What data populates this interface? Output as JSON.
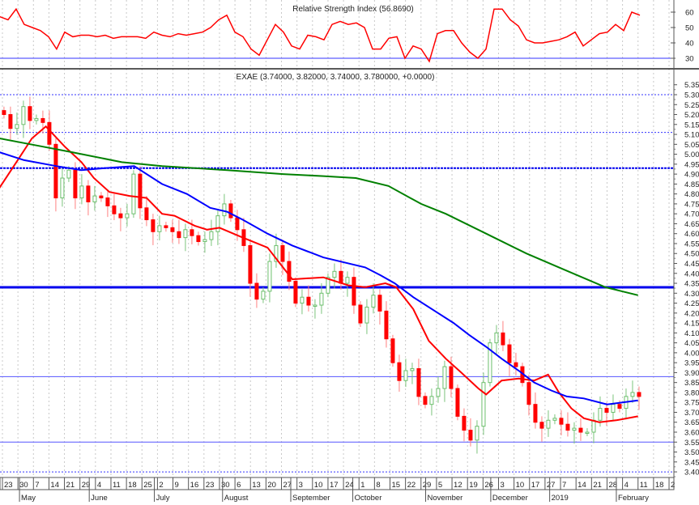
{
  "chart_data": [
    {
      "type": "line",
      "title": "Relative Strength Index (56.8690)",
      "ylim": [
        25,
        65
      ],
      "y_ticks": [
        "60",
        "50",
        "40",
        "30"
      ],
      "y_tick_values": [
        60,
        50,
        40,
        30
      ],
      "reference_line": 30,
      "series": [
        {
          "name": "RSI",
          "color": "#ff0000",
          "x_start_week": -0.16,
          "x_step_week": 0.5225,
          "values": [
            57,
            55,
            62,
            52,
            50,
            48,
            44,
            36,
            47,
            44,
            45,
            45,
            44,
            45,
            43,
            44,
            44,
            44,
            43,
            47,
            45,
            44,
            46,
            45,
            46,
            47,
            50,
            55,
            58,
            47,
            44,
            36,
            32,
            42,
            52,
            47,
            38,
            36,
            45,
            44,
            42,
            52,
            54,
            52,
            53,
            50,
            36,
            36,
            43,
            44,
            30,
            38,
            36,
            28,
            46,
            48,
            48,
            40,
            34,
            30,
            36,
            62,
            62,
            55,
            51,
            42,
            40,
            40,
            41,
            42,
            44,
            47,
            38,
            42,
            46,
            47,
            52,
            48,
            60,
            58
          ]
        }
      ]
    },
    {
      "type": "candlestick",
      "title": "EXAE (3.74000, 3.82000, 3.74000, 3.780000, +0.0000)",
      "ylim": [
        3.4,
        5.35
      ],
      "y_ticks": [
        "5.35",
        "5.30",
        "5.25",
        "5.20",
        "5.15",
        "5.10",
        "5.05",
        "5.00",
        "4.95",
        "4.90",
        "4.85",
        "4.80",
        "4.75",
        "4.70",
        "4.65",
        "4.60",
        "4.55",
        "4.50",
        "4.45",
        "4.40",
        "4.35",
        "4.30",
        "4.25",
        "4.20",
        "4.15",
        "4.10",
        "4.05",
        "4.00",
        "3.95",
        "3.90",
        "3.85",
        "3.80",
        "3.75",
        "3.70",
        "3.65",
        "3.60",
        "3.55",
        "3.50",
        "3.45",
        "3.40"
      ],
      "candles": {
        "x_start_week": 0.1,
        "x_step_week": 0.418,
        "close": [
          5.2,
          5.13,
          5.15,
          5.24,
          5.17,
          5.18,
          5.16,
          5.05,
          4.78,
          4.88,
          4.92,
          4.78,
          4.84,
          4.76,
          4.79,
          4.78,
          4.74,
          4.7,
          4.68,
          4.7,
          4.9,
          4.73,
          4.67,
          4.61,
          4.64,
          4.63,
          4.61,
          4.58,
          4.62,
          4.59,
          4.56,
          4.57,
          4.61,
          4.69,
          4.75,
          4.68,
          4.62,
          4.54,
          4.35,
          4.27,
          4.31,
          4.46,
          4.54,
          4.46,
          4.36,
          4.25,
          4.28,
          4.24,
          4.24,
          4.3,
          4.38,
          4.41,
          4.35,
          4.38,
          4.24,
          4.15,
          4.23,
          4.29,
          4.21,
          4.07,
          3.95,
          3.86,
          3.91,
          3.92,
          3.78,
          3.74,
          3.78,
          3.82,
          3.93,
          3.82,
          3.68,
          3.61,
          3.56,
          3.63,
          3.85,
          4.05,
          4.1,
          4.04,
          3.95,
          3.93,
          3.85,
          3.74,
          3.65,
          3.62,
          3.66,
          3.67,
          3.64,
          3.61,
          3.62,
          3.6,
          3.6,
          3.66,
          3.72,
          3.7,
          3.74,
          3.72,
          3.78,
          3.8,
          3.78
        ],
        "up_color": "#90d090",
        "down_color": "#ff0000"
      },
      "moving_averages": [
        {
          "name": "MA short",
          "color": "#ff0000",
          "points": [
            [
              -0.2,
              4.83
            ],
            [
              0.9,
              4.96
            ],
            [
              1.9,
              5.08
            ],
            [
              2.8,
              5.14
            ],
            [
              4.0,
              5.04
            ],
            [
              5.1,
              4.96
            ],
            [
              5.9,
              4.88
            ],
            [
              6.9,
              4.81
            ],
            [
              8.2,
              4.79
            ],
            [
              9.3,
              4.78
            ],
            [
              10.3,
              4.7
            ],
            [
              11.1,
              4.69
            ],
            [
              12.4,
              4.64
            ],
            [
              13.2,
              4.62
            ],
            [
              14.0,
              4.63
            ],
            [
              15.5,
              4.58
            ],
            [
              17.1,
              4.53
            ],
            [
              17.9,
              4.45
            ],
            [
              18.7,
              4.37
            ],
            [
              20.7,
              4.38
            ],
            [
              22.3,
              4.34
            ],
            [
              23.4,
              4.33
            ],
            [
              24.7,
              4.35
            ],
            [
              25.4,
              4.33
            ],
            [
              26.5,
              4.22
            ],
            [
              27.5,
              4.06
            ],
            [
              28.6,
              3.97
            ],
            [
              29.6,
              3.9
            ],
            [
              30.7,
              3.82
            ],
            [
              31.2,
              3.79
            ],
            [
              32.2,
              3.86
            ],
            [
              33.3,
              3.87
            ],
            [
              34.3,
              3.86
            ],
            [
              35.2,
              3.89
            ],
            [
              35.9,
              3.8
            ],
            [
              36.7,
              3.72
            ],
            [
              37.5,
              3.67
            ],
            [
              38.5,
              3.65
            ],
            [
              39.6,
              3.66
            ],
            [
              41.0,
              3.68
            ]
          ]
        },
        {
          "name": "MA medium",
          "color": "#0000ff",
          "points": [
            [
              -0.2,
              5.01
            ],
            [
              1.4,
              4.97
            ],
            [
              3.5,
              4.94
            ],
            [
              5.1,
              4.92
            ],
            [
              6.6,
              4.93
            ],
            [
              8.5,
              4.94
            ],
            [
              10.3,
              4.85
            ],
            [
              11.9,
              4.8
            ],
            [
              13.4,
              4.73
            ],
            [
              14.5,
              4.71
            ],
            [
              15.5,
              4.67
            ],
            [
              17.1,
              4.6
            ],
            [
              18.7,
              4.54
            ],
            [
              20.7,
              4.48
            ],
            [
              23.4,
              4.43
            ],
            [
              24.4,
              4.39
            ],
            [
              25.3,
              4.35
            ],
            [
              26.5,
              4.28
            ],
            [
              28.1,
              4.2
            ],
            [
              29.1,
              4.15
            ],
            [
              30.1,
              4.09
            ],
            [
              31.2,
              4.03
            ],
            [
              32.2,
              3.97
            ],
            [
              33.3,
              3.91
            ],
            [
              34.3,
              3.85
            ],
            [
              35.4,
              3.81
            ],
            [
              36.4,
              3.78
            ],
            [
              37.5,
              3.77
            ],
            [
              39.0,
              3.74
            ],
            [
              41.0,
              3.76
            ]
          ]
        },
        {
          "name": "MA long",
          "color": "#008000",
          "points": [
            [
              -0.2,
              5.08
            ],
            [
              2.5,
              5.04
            ],
            [
              4.5,
              5.01
            ],
            [
              7.7,
              4.96
            ],
            [
              10.3,
              4.94
            ],
            [
              14.5,
              4.92
            ],
            [
              18.1,
              4.9
            ],
            [
              20.7,
              4.89
            ],
            [
              22.8,
              4.88
            ],
            [
              24.9,
              4.84
            ],
            [
              27.0,
              4.75
            ],
            [
              28.6,
              4.7
            ],
            [
              31.2,
              4.6
            ],
            [
              33.8,
              4.5
            ],
            [
              35.9,
              4.43
            ],
            [
              38.9,
              4.33
            ],
            [
              41.0,
              4.29
            ]
          ]
        }
      ],
      "horizontal_lines": [
        {
          "value": 5.3,
          "style": "dotted",
          "color": "#3333ff"
        },
        {
          "value": 5.11,
          "style": "dotted",
          "color": "#3333ff"
        },
        {
          "value": 4.93,
          "style": "thick-dotted",
          "color": "#0000ee"
        },
        {
          "value": 4.33,
          "style": "thick",
          "color": "#0000ee"
        },
        {
          "value": 3.88,
          "style": "solid",
          "color": "#5555ff"
        },
        {
          "value": 3.55,
          "style": "solid",
          "color": "#5555ff"
        },
        {
          "value": 3.4,
          "style": "dotted",
          "color": "#3333ff"
        }
      ]
    }
  ],
  "x_axis": {
    "week_labels": [
      "23",
      "30",
      "7",
      "14",
      "21",
      "29",
      "4",
      "11",
      "18",
      "25",
      "2",
      "9",
      "16",
      "23",
      "30",
      "6",
      "13",
      "20",
      "27",
      "3",
      "10",
      "17",
      "24",
      "1",
      "8",
      "15",
      "22",
      "29",
      "5",
      "12",
      "19",
      "26",
      "3",
      "10",
      "17",
      "27",
      "7",
      "14",
      "21",
      "28",
      "4",
      "11",
      "18",
      "2"
    ],
    "months": [
      {
        "label": "May",
        "week": 1.1
      },
      {
        "label": "June",
        "week": 5.6
      },
      {
        "label": "July",
        "week": 9.8
      },
      {
        "label": "August",
        "week": 14.2
      },
      {
        "label": "September",
        "week": 18.6
      },
      {
        "label": "October",
        "week": 22.6
      },
      {
        "label": "November",
        "week": 27.3
      },
      {
        "label": "December",
        "week": 31.5
      },
      {
        "label": "2019",
        "week": 35.3
      },
      {
        "label": "February",
        "week": 39.6
      }
    ]
  }
}
